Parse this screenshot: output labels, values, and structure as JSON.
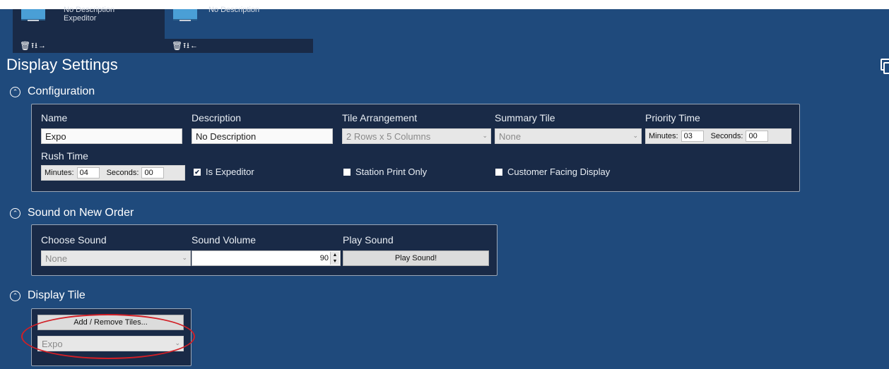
{
  "stations": [
    {
      "line1": "No Description",
      "line2": "Expeditor",
      "arrow": "→"
    },
    {
      "line1": "No Description",
      "line2": "",
      "arrow": "←"
    }
  ],
  "page_title": "Display Settings",
  "configuration": {
    "heading": "Configuration",
    "name_label": "Name",
    "name_value": "Expo",
    "description_label": "Description",
    "description_value": "No Description",
    "tile_arrangement_label": "Tile Arrangement",
    "tile_arrangement_value": "2 Rows x 5 Columns",
    "summary_tile_label": "Summary Tile",
    "summary_tile_value": "None",
    "priority_time_label": "Priority Time",
    "priority_minutes_label": "Minutes:",
    "priority_minutes": "03",
    "priority_seconds_label": "Seconds:",
    "priority_seconds": "00",
    "rush_time_label": "Rush Time",
    "rush_minutes_label": "Minutes:",
    "rush_minutes": "04",
    "rush_seconds_label": "Seconds:",
    "rush_seconds": "00",
    "is_expeditor_label": "Is Expeditor",
    "is_expeditor_checked": true,
    "station_print_only_label": "Station Print Only",
    "station_print_only_checked": false,
    "customer_facing_label": "Customer Facing Display",
    "customer_facing_checked": false
  },
  "sound": {
    "heading": "Sound on New Order",
    "choose_label": "Choose Sound",
    "choose_value": "None",
    "volume_label": "Sound Volume",
    "volume_value": "90",
    "play_label": "Play Sound",
    "play_button": "Play Sound!"
  },
  "display_tile": {
    "heading": "Display Tile",
    "add_remove_button": "Add / Remove Tiles...",
    "tile_value": "Expo"
  },
  "colors": {
    "background": "#1f4a7c",
    "panel": "#192a47",
    "highlight": "#d11f26"
  }
}
